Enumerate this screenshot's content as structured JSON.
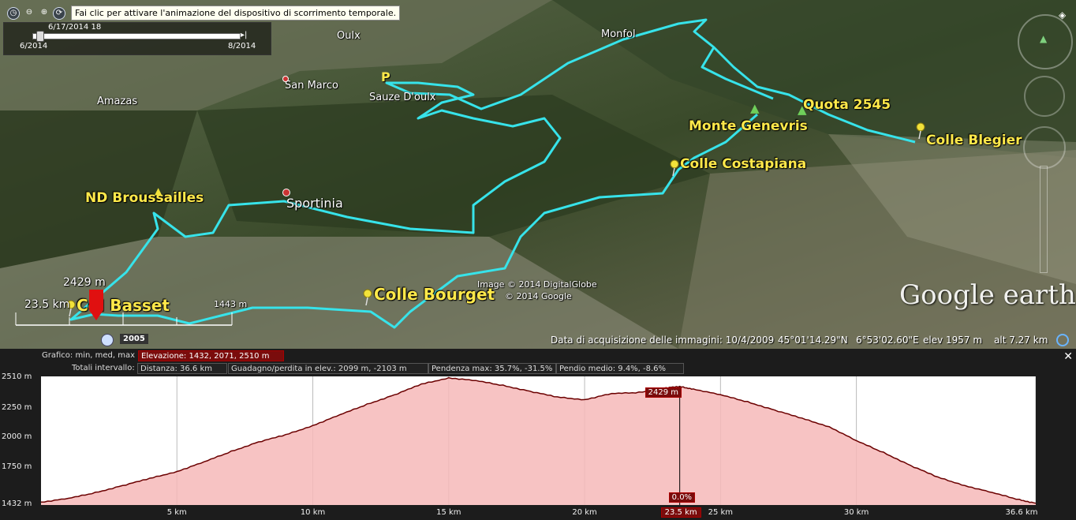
{
  "toolbar": {
    "tooltip": "Fai clic per attivare l'animazione del dispositivo di scorrimento temporale."
  },
  "timeslider": {
    "current": "6/17/2014 18",
    "start": "6/2014",
    "end": "8/2014",
    "year_badge": "2005"
  },
  "map": {
    "places": {
      "oulx": "Oulx",
      "monfol": "Monfol",
      "san_marco": "San Marco",
      "sauze": "Sauze D'oulx",
      "amazas": "Amazas",
      "sportinia": "Sportinia"
    },
    "points": {
      "quota": "Quota 2545",
      "monte": "Monte Genevris",
      "blegier": "Colle Blegier",
      "costapiana": "Colle Costapiana",
      "broussailles": "ND Broussailles",
      "col_basset": "Col Basset",
      "bourget": "Colle Bourget"
    },
    "parking": "P",
    "elev_marker": "2429 m",
    "dist_marker": "23.5 km",
    "elev_left": "1443 m",
    "credit1": "Image © 2014 DigitalGlobe",
    "credit2": "© 2014 Google",
    "logo": "Google earth"
  },
  "status": {
    "acq": "Data di acquisizione delle immagini: 10/4/2009",
    "lat": "45°01'14.29\"N",
    "lon": "6°53'02.60\"E",
    "elev": "elev  1957 m",
    "alt": "alt   7.27 km"
  },
  "profile": {
    "graph_label": "Grafico: min, med, max",
    "elevation": "Elevazione: 1432, 2071, 2510 m",
    "totals_label": "Totali intervallo:",
    "distance": "Distanza: 36.6 km",
    "gain": "Guadagno/perdita in elev.: 2099 m, -2103 m",
    "slope_max": "Pendenza max: 35.7%, -31.5%",
    "slope_avg": "Pendio medio: 9.4%, -8.6%",
    "close": "✕",
    "marker_elev": "2429 m",
    "marker_slope": "0.0%",
    "marker_dist": "23.5 km"
  },
  "chart_data": {
    "type": "area",
    "xlabel": "",
    "ylabel": "",
    "x_unit": "km",
    "y_unit": "m",
    "xlim": [
      0,
      36.6
    ],
    "ylim": [
      1432,
      2510
    ],
    "y_ticks": [
      "2510 m",
      "2250 m",
      "2000 m",
      "1750 m",
      "1432 m"
    ],
    "y_tick_values": [
      2510,
      2250,
      2000,
      1750,
      1432
    ],
    "x_ticks": [
      "5 km",
      "10 km",
      "15 km",
      "20 km",
      "25 km",
      "30 km",
      "36.6 km"
    ],
    "x_tick_values": [
      5,
      10,
      15,
      20,
      25,
      30,
      36.6
    ],
    "fill_color": "#f6b9b9",
    "line_color": "#6b0000",
    "x": [
      0,
      1,
      2,
      3,
      4,
      5,
      6,
      7,
      8,
      9,
      10,
      11,
      12,
      13,
      14,
      15,
      16,
      17,
      18,
      19,
      20,
      21,
      22,
      23,
      23.5,
      24,
      25,
      26,
      27,
      28,
      29,
      30,
      31,
      32,
      33,
      34,
      35,
      36,
      36.6
    ],
    "y": [
      1450,
      1480,
      1530,
      1590,
      1650,
      1710,
      1790,
      1880,
      1960,
      2020,
      2100,
      2190,
      2280,
      2360,
      2450,
      2505,
      2480,
      2440,
      2390,
      2340,
      2320,
      2370,
      2380,
      2420,
      2429,
      2410,
      2360,
      2300,
      2230,
      2160,
      2090,
      1970,
      1870,
      1760,
      1660,
      1590,
      1530,
      1470,
      1440
    ]
  }
}
